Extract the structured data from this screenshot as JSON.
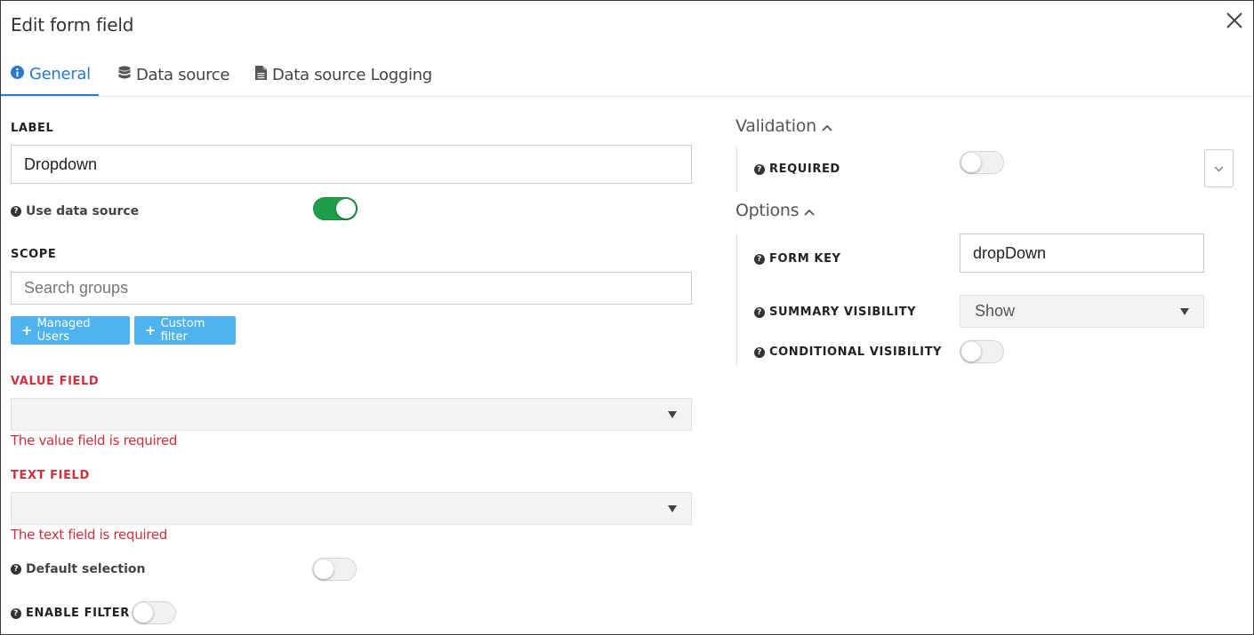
{
  "dialog": {
    "title": "Edit form field"
  },
  "tabs": [
    {
      "label": "General",
      "icon": "info-circle-icon",
      "active": true
    },
    {
      "label": "Data source",
      "icon": "database-icon",
      "active": false
    },
    {
      "label": "Data source Logging",
      "icon": "document-icon",
      "active": false
    }
  ],
  "general": {
    "label_heading": "LABEL",
    "label_value": "Dropdown",
    "use_data_source": {
      "label": "Use data source",
      "on": true
    },
    "scope_heading": "SCOPE",
    "scope_placeholder": "Search groups",
    "managed_users_button": "Managed Users",
    "custom_filter_button": "Custom filter",
    "value_field": {
      "heading": "VALUE FIELD",
      "value": "",
      "error": "The value field is required"
    },
    "text_field": {
      "heading": "TEXT FIELD",
      "value": "",
      "error": "The text field is required"
    },
    "default_selection": {
      "label": "Default selection",
      "on": false
    },
    "enable_filter": {
      "label": "ENABLE FILTER",
      "on": false
    }
  },
  "validation": {
    "heading": "Validation",
    "required": {
      "label": "REQUIRED",
      "on": false
    }
  },
  "options": {
    "heading": "Options",
    "form_key": {
      "label": "FORM KEY",
      "value": "dropDown"
    },
    "summary_visibility": {
      "label": "SUMMARY VISIBILITY",
      "value": "Show"
    },
    "conditional_visibility": {
      "label": "CONDITIONAL VISIBILITY",
      "on": false
    }
  },
  "colors": {
    "accent": "#2b7ac9",
    "toggle_on": "#1e9e4a",
    "button": "#4fb3ee",
    "error": "#d0303c"
  }
}
